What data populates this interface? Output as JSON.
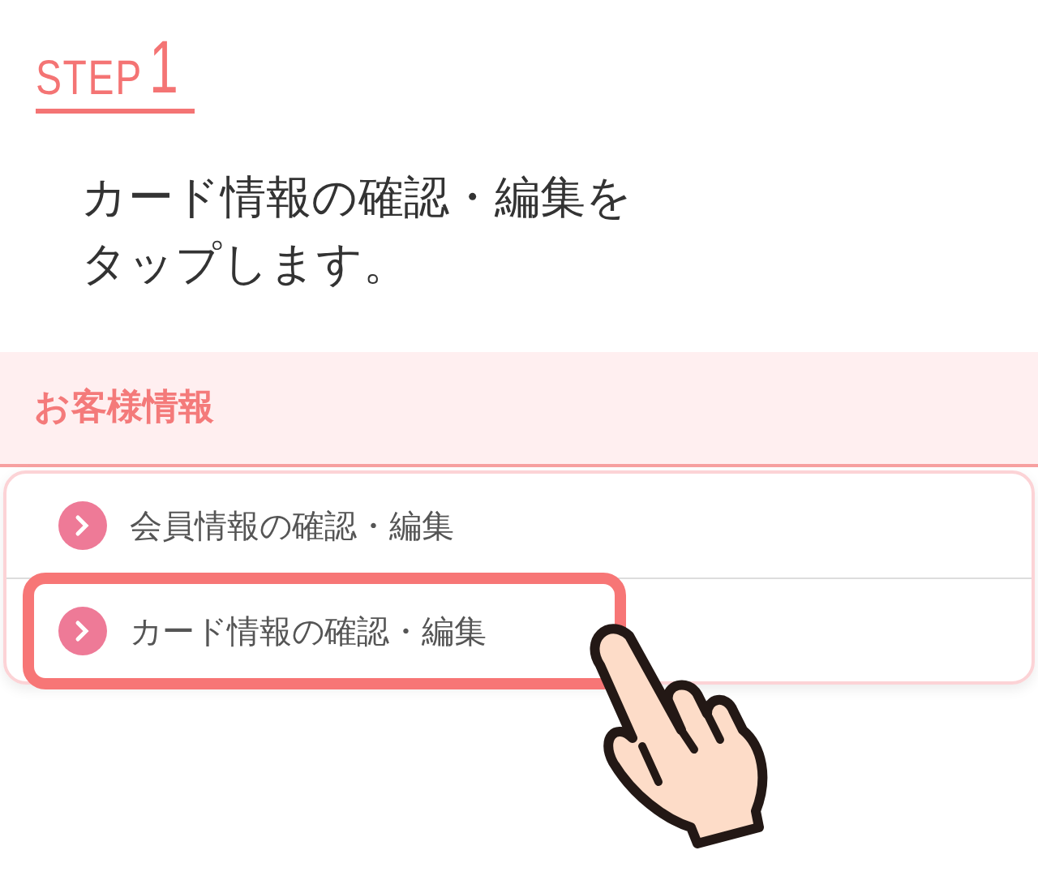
{
  "step": {
    "label": "STEP",
    "number": "1"
  },
  "instruction": "カード情報の確認・編集をタップします。",
  "section": {
    "title": "お客様情報",
    "items": [
      {
        "label": "会員情報の確認・編集",
        "highlighted": false
      },
      {
        "label": "カード情報の確認・編集",
        "highlighted": true
      }
    ]
  }
}
